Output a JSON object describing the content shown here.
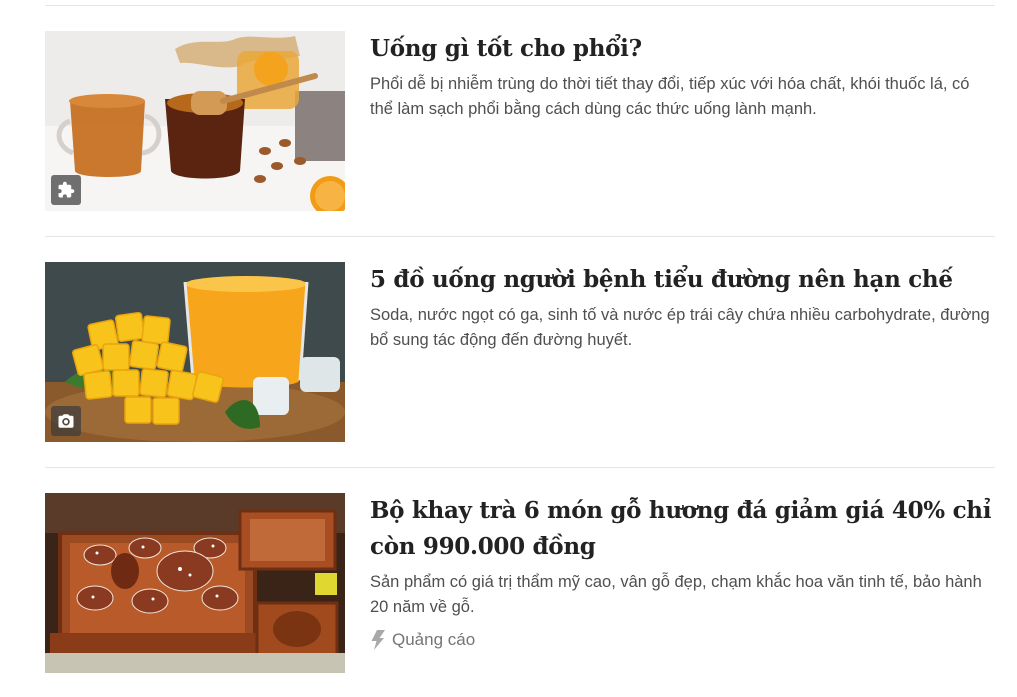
{
  "articles": [
    {
      "title": "Uống gì tốt cho phổi?",
      "description": "Phổi dễ bị nhiễm trùng do thời tiết thay đổi, tiếp xúc với hóa chất, khói thuốc lá, có thể làm sạch phổi bằng cách dùng các thức uống lành mạnh.",
      "media_icon": "puzzle-icon",
      "image": "tea-honey-ginger-photo"
    },
    {
      "title": "5 đồ uống người bệnh tiểu đường nên hạn chế",
      "description": "Soda, nước ngọt có ga, sinh tố và nước ép trái cây chứa nhiều carbohydrate, đường bổ sung tác động đến đường huyết.",
      "media_icon": "camera-icon",
      "image": "mango-juice-photo"
    },
    {
      "title": "Bộ khay trà 6 món gỗ hương đá giảm giá 40% chỉ còn 990.000 đồng",
      "description": "Sản phẩm có giá trị thẩm mỹ cao, vân gỗ đẹp, chạm khắc hoa văn tinh tế, bảo hành 20 năm về gỗ.",
      "sponsored_label": "Quảng cáo",
      "sponsored_icon": "lightning-icon",
      "image": "wooden-tea-tray-photo"
    }
  ]
}
